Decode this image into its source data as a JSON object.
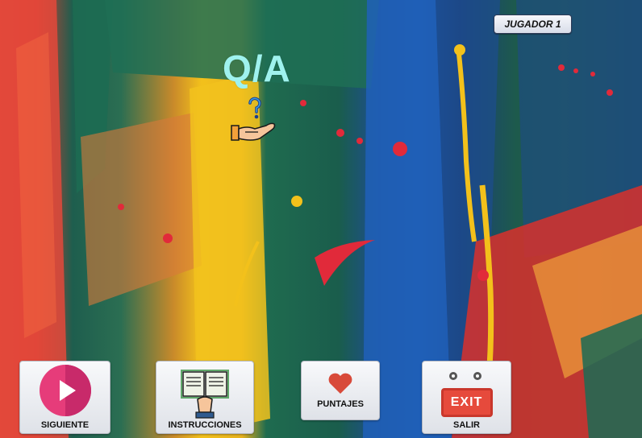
{
  "title": "Q/A",
  "player_badge": "JUGADOR 1",
  "buttons": {
    "next": "SIGUIENTE",
    "instructions": "INSTRUCCIONES",
    "scores": "PUNTAJES",
    "exit": "SALIR",
    "exit_sign": "EXIT"
  },
  "icons": {
    "title": "question-hand-icon",
    "next": "play-icon",
    "instructions": "book-hand-icon",
    "scores": "heart-icon",
    "exit": "exit-sign-icon"
  },
  "colors": {
    "title": "#9ff2ee",
    "play": "#e63c7a",
    "heart": "#d84a3a",
    "exit": "#e64a3c"
  }
}
